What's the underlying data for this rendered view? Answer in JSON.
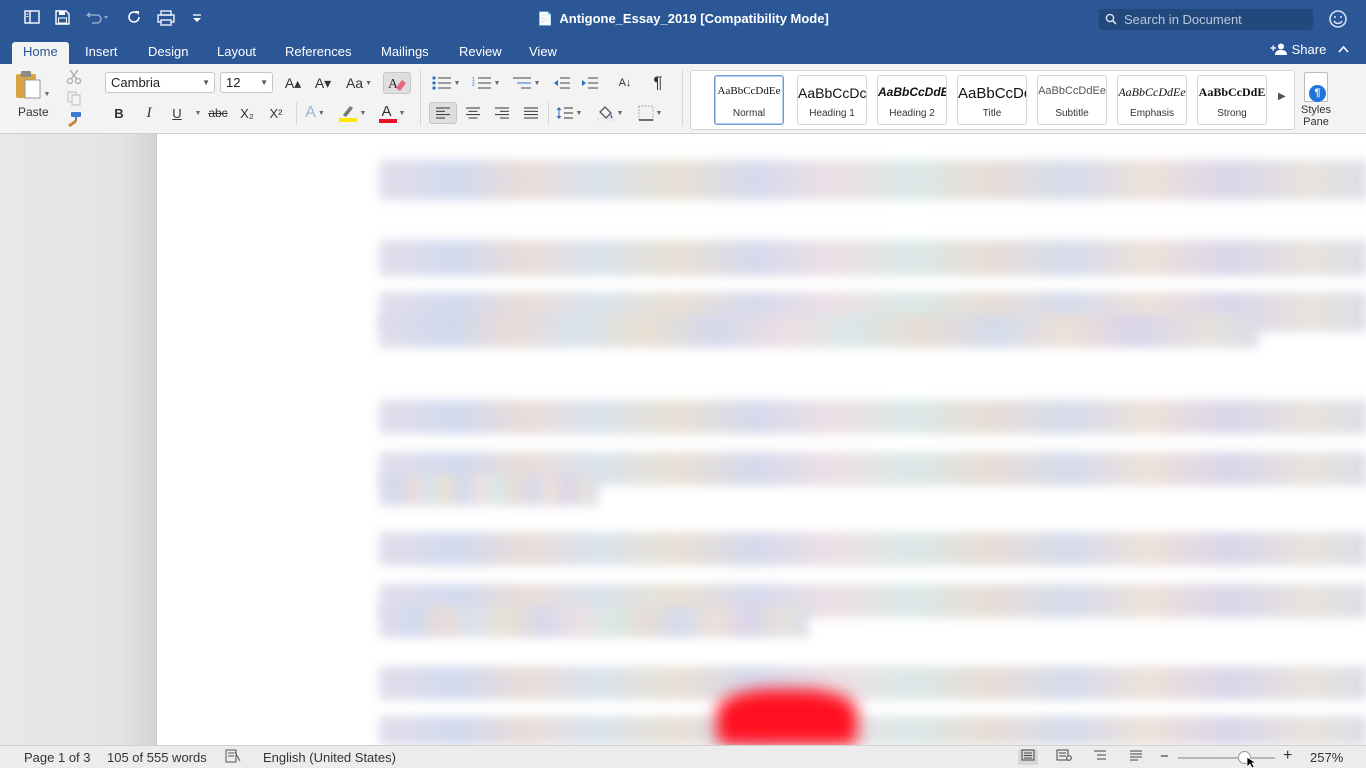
{
  "titlebar": {
    "title": "Antigone_Essay_2019 [Compatibility Mode]",
    "doc_glyph": "📄",
    "search_placeholder": "Search in Document",
    "icons": [
      "sidebar-icon",
      "save-icon",
      "undo-icon",
      "redo-icon",
      "print-icon",
      "customize-icon",
      "smiley-icon"
    ]
  },
  "tabs": [
    "Home",
    "Insert",
    "Design",
    "Layout",
    "References",
    "Mailings",
    "Review",
    "View"
  ],
  "active_tab": "Home",
  "share_label": "Share",
  "ribbon": {
    "paste_label": "Paste",
    "font_name": "Cambria",
    "font_size": "12",
    "bold": "B",
    "italic": "I",
    "underline": "U",
    "strike": "abc",
    "subscript": "X₂",
    "superscript": "X²",
    "grow": "A▴",
    "shrink": "A▾",
    "change_case": "Aa",
    "font_color_label": "A",
    "text_effects_label": "A",
    "pilcrow": "¶",
    "sort": "A↓",
    "font_color": "#e81123",
    "highlight_color": "#ffe800"
  },
  "styles": [
    {
      "preview": "AaBbCcDdEe",
      "name": "Normal",
      "selected": true
    },
    {
      "preview": "AaBbCcDc",
      "name": "Heading 1",
      "selected": false
    },
    {
      "preview": "AaBbCcDdE",
      "name": "Heading 2",
      "selected": false
    },
    {
      "preview": "AaBbCcDc",
      "name": "Title",
      "selected": false
    },
    {
      "preview": "AaBbCcDdEe",
      "name": "Subtitle",
      "selected": false
    },
    {
      "preview": "AaBbCcDdEe",
      "name": "Emphasis",
      "selected": false
    },
    {
      "preview": "AaBbCcDdE",
      "name": "Strong",
      "selected": false
    }
  ],
  "styles_pane": {
    "line1": "Styles",
    "line2": "Pane",
    "icon_glyph": "¶"
  },
  "status": {
    "page": "Page 1 of 3",
    "words": "105 of 555 words",
    "language": "English (United States)",
    "zoom": "257%",
    "zoom_minus": "−",
    "zoom_plus": "+"
  },
  "theme": {
    "accent": "#2b5797"
  }
}
